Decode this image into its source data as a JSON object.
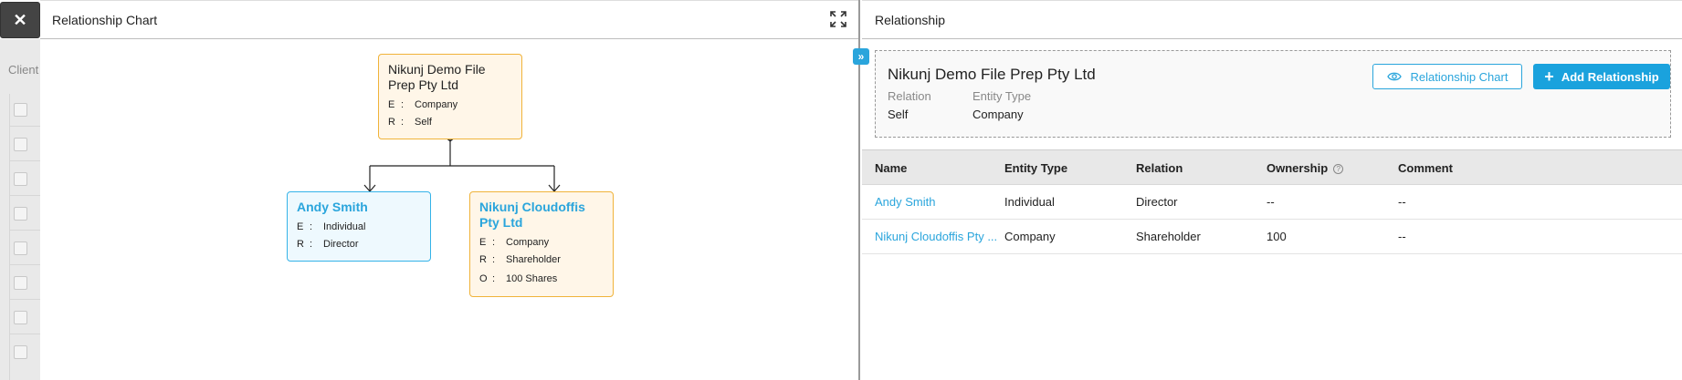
{
  "background": {
    "client_label": "Client"
  },
  "close_button": {
    "label": "✕"
  },
  "chart_panel": {
    "title": "Relationship Chart",
    "root": {
      "name": "Nikunj Demo File Prep Pty Ltd",
      "rows": [
        {
          "key": "E",
          "sep": ":",
          "value": "Company"
        },
        {
          "key": "R",
          "sep": ":",
          "value": "Self"
        }
      ]
    },
    "children": [
      {
        "name": "Andy Smith",
        "rows": [
          {
            "key": "E",
            "sep": ":",
            "value": "Individual"
          },
          {
            "key": "R",
            "sep": ":",
            "value": "Director"
          }
        ]
      },
      {
        "name": "Nikunj Cloudoffis Pty Ltd",
        "rows": [
          {
            "key": "E",
            "sep": ":",
            "value": "Company"
          },
          {
            "key": "R",
            "sep": ":",
            "value": "Shareholder"
          },
          {
            "key": "O",
            "sep": ":",
            "value": "100 Shares"
          }
        ]
      }
    ]
  },
  "rel_panel": {
    "title": "Relationship",
    "collapse_icon": "»",
    "summary": {
      "name": "Nikunj Demo File Prep Pty Ltd",
      "relation_label": "Relation",
      "relation_value": "Self",
      "entity_type_label": "Entity Type",
      "entity_type_value": "Company",
      "chart_button": "Relationship Chart",
      "add_button": "Add Relationship"
    },
    "table": {
      "headers": [
        "Name",
        "Entity Type",
        "Relation",
        "Ownership",
        "Comment"
      ],
      "rows": [
        [
          "Andy Smith",
          "Individual",
          "Director",
          "--",
          "--"
        ],
        [
          "Nikunj Cloudoffis Pty ...",
          "Company",
          "Shareholder",
          "100",
          "--"
        ]
      ]
    }
  },
  "colors": {
    "accent": "#1aa2dd",
    "node_orange_border": "#f0b33a",
    "node_blue_border": "#35b3e8"
  }
}
